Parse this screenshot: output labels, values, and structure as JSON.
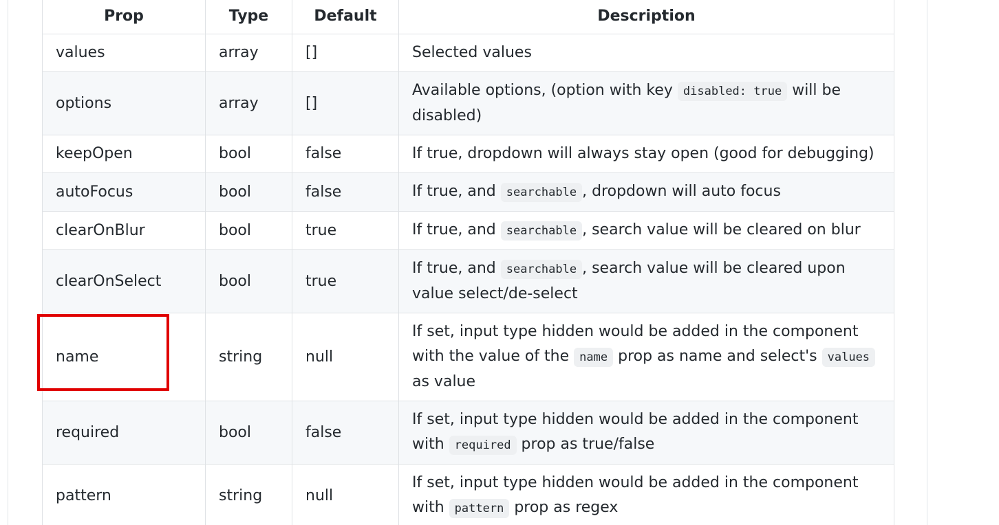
{
  "table": {
    "headers": [
      "Prop",
      "Type",
      "Default",
      "Description"
    ],
    "rows": [
      {
        "prop": "values",
        "type": "array",
        "default": "[]",
        "description": [
          {
            "t": "Selected values"
          }
        ]
      },
      {
        "prop": "options",
        "type": "array",
        "default": "[]",
        "description": [
          {
            "t": "Available options, (option with key "
          },
          {
            "code": "disabled: true"
          },
          {
            "t": " will be disabled)"
          }
        ]
      },
      {
        "prop": "keepOpen",
        "type": "bool",
        "default": "false",
        "description": [
          {
            "t": "If true, dropdown will always stay open (good for debugging)"
          }
        ]
      },
      {
        "prop": "autoFocus",
        "type": "bool",
        "default": "false",
        "description": [
          {
            "t": "If true, and "
          },
          {
            "code": "searchable"
          },
          {
            "t": ", dropdown will auto focus"
          }
        ]
      },
      {
        "prop": "clearOnBlur",
        "type": "bool",
        "default": "true",
        "description": [
          {
            "t": "If true, and "
          },
          {
            "code": "searchable"
          },
          {
            "t": ", search value will be cleared on blur"
          }
        ]
      },
      {
        "prop": "clearOnSelect",
        "type": "bool",
        "default": "true",
        "description": [
          {
            "t": "If true, and "
          },
          {
            "code": "searchable"
          },
          {
            "t": ", search value will be cleared upon value select/de-select"
          }
        ]
      },
      {
        "prop": "name",
        "type": "string",
        "default": "null",
        "description": [
          {
            "t": "If set, input type hidden would be added in the component with the value of the "
          },
          {
            "code": "name"
          },
          {
            "t": " prop as name and select's "
          },
          {
            "code": "values"
          },
          {
            "t": " as value"
          }
        ]
      },
      {
        "prop": "required",
        "type": "bool",
        "default": "false",
        "description": [
          {
            "t": "If set, input type hidden would be added in the component with "
          },
          {
            "code": "required"
          },
          {
            "t": " prop as true/false"
          }
        ]
      },
      {
        "prop": "pattern",
        "type": "string",
        "default": "null",
        "description": [
          {
            "t": "If set, input type hidden would be added in the component with "
          },
          {
            "code": "pattern"
          },
          {
            "t": " prop as regex"
          }
        ]
      }
    ]
  },
  "highlight": {
    "target_prop": "name",
    "color": "#e00000"
  },
  "colors": {
    "text": "#24292e",
    "border": "#dfe2e5",
    "stripe": "#f6f8fa",
    "code_bg": "#eef0f2"
  }
}
